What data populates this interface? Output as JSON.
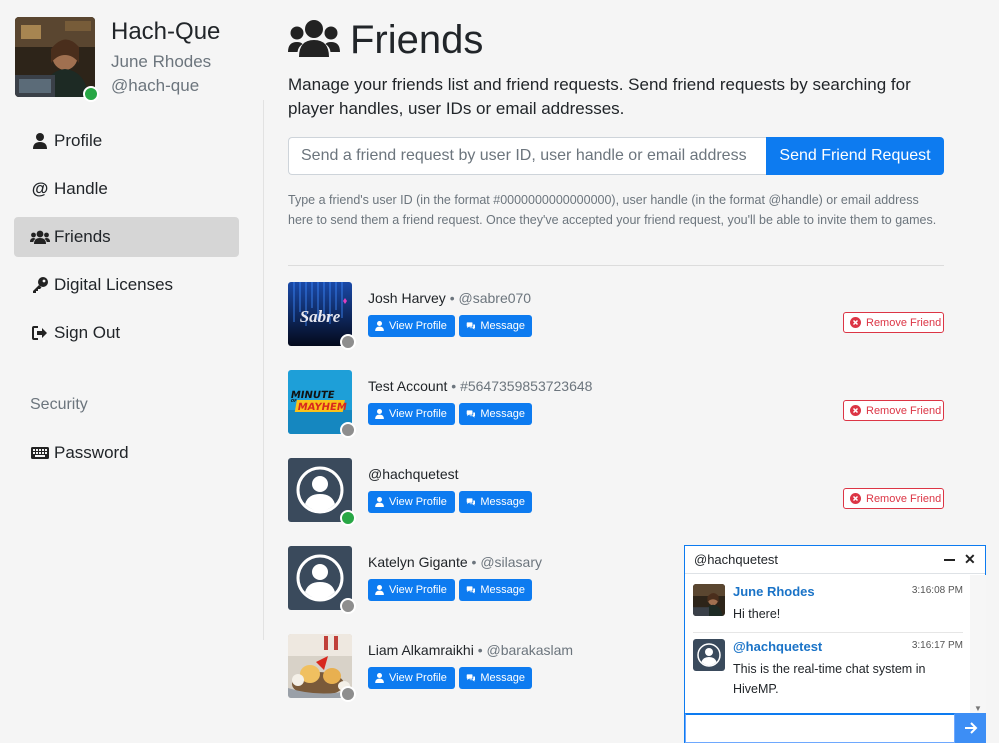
{
  "profile": {
    "display_name": "Hach-Que",
    "real_name": "June Rhodes",
    "handle": "@hach-que",
    "status_color": "#28a745"
  },
  "nav": {
    "items": [
      {
        "label": "Profile",
        "icon": "user-icon"
      },
      {
        "label": "Handle",
        "icon": "at-icon"
      },
      {
        "label": "Friends",
        "icon": "users-icon",
        "active": true
      },
      {
        "label": "Digital Licenses",
        "icon": "key-icon"
      },
      {
        "label": "Sign Out",
        "icon": "sign-out-icon"
      }
    ],
    "security_heading": "Security",
    "security_items": [
      {
        "label": "Password",
        "icon": "keyboard-icon"
      }
    ]
  },
  "page": {
    "title": "Friends",
    "lead": "Manage your friends list and friend requests. Send friend requests by searching for player handles, user IDs or email addresses.",
    "search_placeholder": "Send a friend request by user ID, user handle or email address",
    "send_label": "Send Friend Request",
    "help": "Type a friend's user ID (in the format #0000000000000000), user handle (in the format @handle) or email address here to send them a friend request. Once they've accepted your friend request, you'll be able to invite them to games."
  },
  "friends": [
    {
      "name": "Josh Harvey",
      "sep": " • ",
      "sub": "@sabre070",
      "status": "offline",
      "avatar": "sabre-logo",
      "removable": true
    },
    {
      "name": "Test Account",
      "sep": " • ",
      "sub": "#5647359853723648",
      "status": "offline",
      "avatar": "minute-of-mayhem-logo",
      "removable": true
    },
    {
      "name": "@hachquetest",
      "sep": "",
      "sub": "",
      "status": "online",
      "avatar": "default-avatar",
      "removable": true
    },
    {
      "name": "Katelyn Gigante",
      "sep": " • ",
      "sub": "@silasary",
      "status": "offline",
      "avatar": "default-avatar",
      "removable": false
    },
    {
      "name": "Liam Alkamraikhi",
      "sep": " • ",
      "sub": "@barakaslam",
      "status": "offline",
      "avatar": "party-photo",
      "removable": false
    }
  ],
  "buttons": {
    "view_profile": "View Profile",
    "message": "Message",
    "remove_friend": "Remove Friend"
  },
  "sabre_text": "Sabre",
  "mayhem_text": {
    "line1": "MINUTE",
    "line2": "MAYHEM",
    "of": "OF"
  },
  "chat": {
    "title": "@hachquetest",
    "messages": [
      {
        "author": "June Rhodes",
        "time": "3:16:08 PM",
        "text": "Hi there!"
      },
      {
        "author": "@hachquetest",
        "time": "3:16:17 PM",
        "text": "This is the real-time chat system in HiveMP."
      }
    ],
    "input_value": ""
  },
  "colors": {
    "primary": "#0d7bf0",
    "danger": "#dc3545",
    "online": "#28a745",
    "offline": "#8e8e8e"
  }
}
